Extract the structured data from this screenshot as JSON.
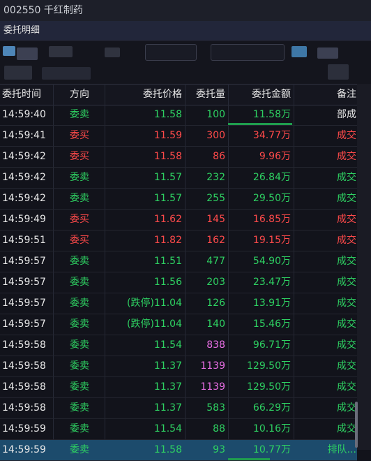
{
  "window": {
    "title": "002550 千红制药"
  },
  "panel": {
    "title": "委托明细"
  },
  "columns": {
    "time": "委托时间",
    "direction": "方向",
    "price": "委托价格",
    "volume": "委托量",
    "amount": "委托金额",
    "note": "备注"
  },
  "rows": [
    {
      "time": "14:59:40",
      "direction": "委卖",
      "price": "11.58",
      "volume": "100",
      "amount": "11.58万",
      "note": "部成"
    },
    {
      "time": "14:59:41",
      "direction": "委买",
      "price": "11.59",
      "volume": "300",
      "amount": "34.77万",
      "note": "成交"
    },
    {
      "time": "14:59:42",
      "direction": "委买",
      "price": "11.58",
      "volume": "86",
      "amount": "9.96万",
      "note": "成交"
    },
    {
      "time": "14:59:42",
      "direction": "委卖",
      "price": "11.57",
      "volume": "232",
      "amount": "26.84万",
      "note": "成交"
    },
    {
      "time": "14:59:42",
      "direction": "委卖",
      "price": "11.57",
      "volume": "255",
      "amount": "29.50万",
      "note": "成交"
    },
    {
      "time": "14:59:49",
      "direction": "委买",
      "price": "11.62",
      "volume": "145",
      "amount": "16.85万",
      "note": "成交"
    },
    {
      "time": "14:59:51",
      "direction": "委买",
      "price": "11.82",
      "volume": "162",
      "amount": "19.15万",
      "note": "成交"
    },
    {
      "time": "14:59:57",
      "direction": "委卖",
      "price": "11.51",
      "volume": "477",
      "amount": "54.90万",
      "note": "成交"
    },
    {
      "time": "14:59:57",
      "direction": "委卖",
      "price": "11.56",
      "volume": "203",
      "amount": "23.47万",
      "note": "成交"
    },
    {
      "time": "14:59:57",
      "direction": "委卖",
      "price": "(跌停)11.04",
      "volume": "126",
      "amount": "13.91万",
      "note": "成交"
    },
    {
      "time": "14:59:57",
      "direction": "委卖",
      "price": "(跌停)11.04",
      "volume": "140",
      "amount": "15.46万",
      "note": "成交"
    },
    {
      "time": "14:59:58",
      "direction": "委卖",
      "price": "11.54",
      "volume": "838",
      "amount": "96.71万",
      "note": "成交"
    },
    {
      "time": "14:59:58",
      "direction": "委卖",
      "price": "11.37",
      "volume": "1139",
      "amount": "129.50万",
      "note": "成交"
    },
    {
      "time": "14:59:58",
      "direction": "委卖",
      "price": "11.37",
      "volume": "1139",
      "amount": "129.50万",
      "note": "成交"
    },
    {
      "time": "14:59:58",
      "direction": "委卖",
      "price": "11.37",
      "volume": "583",
      "amount": "66.29万",
      "note": "成交"
    },
    {
      "time": "14:59:59",
      "direction": "委卖",
      "price": "11.54",
      "volume": "88",
      "amount": "10.16万",
      "note": "成交"
    },
    {
      "time": "14:59:59",
      "direction": "委卖",
      "price": "11.58",
      "volume": "93",
      "amount": "10.77万",
      "note": "排队..."
    }
  ],
  "colors": {
    "buy": "#ff4a4a",
    "sell": "#2ed162",
    "big_volume": "#e86ee4",
    "selected_row": "#1c4b6c"
  }
}
